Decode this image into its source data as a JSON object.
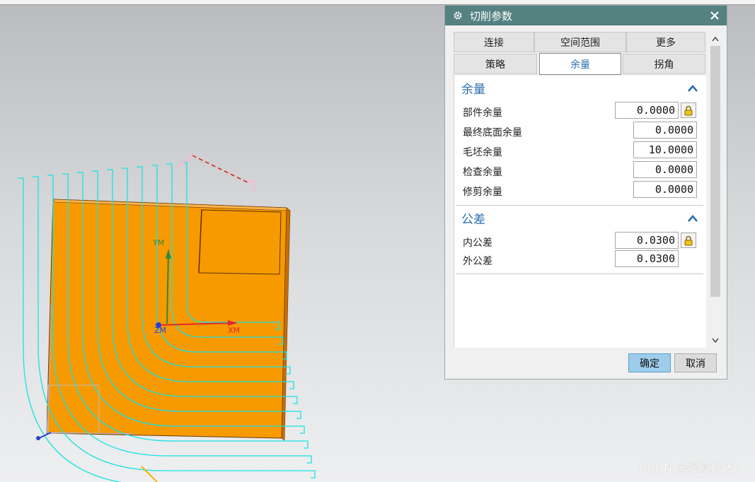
{
  "dialog": {
    "title": "切削参数",
    "tabs_row1": [
      "连接",
      "空间范围",
      "更多"
    ],
    "tabs_row2": [
      "策略",
      "余量",
      "拐角"
    ],
    "active_tab": "余量",
    "sections": [
      {
        "title": "余量",
        "rows": [
          {
            "label": "部件余量",
            "value": "0.0000",
            "locked": true
          },
          {
            "label": "最终底面余量",
            "value": "0.0000",
            "locked": false
          },
          {
            "label": "毛坯余量",
            "value": "10.0000",
            "locked": false
          },
          {
            "label": "检查余量",
            "value": "0.0000",
            "locked": false
          },
          {
            "label": "修剪余量",
            "value": "0.0000",
            "locked": false
          }
        ]
      },
      {
        "title": "公差",
        "rows": [
          {
            "label": "内公差",
            "value": "0.0300",
            "locked": true
          },
          {
            "label": "外公差",
            "value": "0.0300",
            "locked": false
          }
        ]
      }
    ],
    "ok_label": "确定",
    "cancel_label": "取消"
  },
  "viewport": {
    "axis_labels": {
      "ym": "YM",
      "xm": "XM",
      "zm": "ZM"
    },
    "part_color": "#f79a00",
    "toolpath_color": "#19e3e3",
    "x_axis_color": "#e02a2a",
    "y_axis_color": "#2f8a3a",
    "z_axis_color": "#2a3fd6"
  },
  "watermark": "CSDN @是真的大！",
  "icons": {
    "title": "gear-icon",
    "close": "close-icon",
    "lock": "lock-icon",
    "collapse": "chevron-up-icon",
    "scroll_up": "chevron-up-icon",
    "scroll_down": "chevron-down-icon"
  }
}
